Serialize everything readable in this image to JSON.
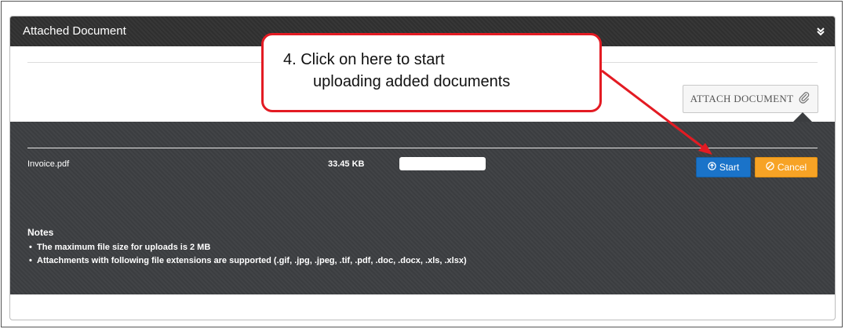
{
  "panel": {
    "title": "Attached Document",
    "attach_button_label": "ATTACH DOCUMENT"
  },
  "file": {
    "name": "Invoice.pdf",
    "size": "33.45 KB",
    "progress": 0,
    "start_label": "Start",
    "cancel_label": "Cancel"
  },
  "notes": {
    "title": "Notes",
    "items": [
      "The maximum file size for uploads is 2 MB",
      "Attachments with following file extensions are supported (.gif, .jpg, .jpeg, .tif, .pdf, .doc, .docx, .xls, .xlsx)"
    ]
  },
  "callout": {
    "line1": "4. Click on here to start",
    "line2": "uploading added documents"
  },
  "colors": {
    "start_button": "#1a73c9",
    "cancel_button": "#f7a325",
    "callout_border": "#e31b23",
    "header_bg": "#2f2f2f",
    "dark_area": "#3b3d40"
  },
  "icons": {
    "collapse": "double-chevron-down-icon",
    "attach": "paperclip-icon",
    "start": "upload-circle-icon",
    "cancel": "ban-icon"
  }
}
